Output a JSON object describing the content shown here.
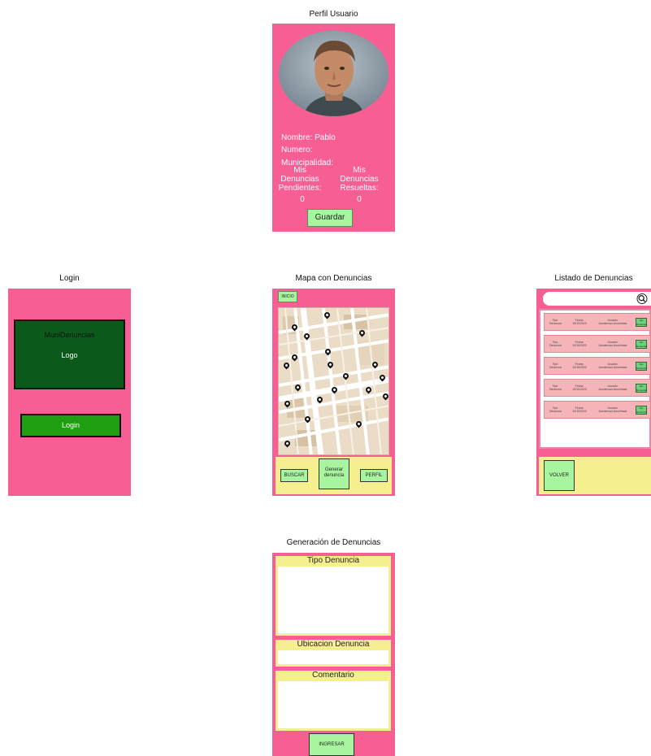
{
  "perfil": {
    "title": "Perfil Usuario",
    "nombre": "Nombre: Pablo",
    "numero": "Numero:",
    "municipalidad": "Municipalidad:",
    "pendientes_label": "Mis\nDenuncias\nPendientes:",
    "pendientes_value": "0",
    "resueltas_label": "Mis\nDenuncias\nResueltas:",
    "resueltas_value": "0",
    "guardar": "Guardar"
  },
  "login": {
    "title": "Login",
    "app_name": "MuniDenuncias",
    "logo": "Logo",
    "login_button": "Login"
  },
  "mapa": {
    "title": "Mapa con Denuncias",
    "inicio": "INICIO",
    "buscar": "BUSCAR",
    "generar": "Generar\ndenuncia",
    "perfil": "PERFIL"
  },
  "listado": {
    "title": "Listado de Denuncias",
    "rows": [
      {
        "tipo": "Tipo\nDenuncia",
        "fecha": "Fecha:\n10/10/2022",
        "usuario": "Usuario:\nAnonimous Anonimato",
        "action": "Ver\nDenuncia"
      },
      {
        "tipo": "Tipo\nDenuncia",
        "fecha": "Fecha:\n10/10/2022",
        "usuario": "Usuario:\nAnonimous Anonimato",
        "action": "Ver\nDenuncia"
      },
      {
        "tipo": "Tipo\nDenuncia",
        "fecha": "Fecha:\n10/10/2022",
        "usuario": "Usuario:\nAnonimous Anonimato",
        "action": "Ver\nDenuncia"
      },
      {
        "tipo": "Tipo\nDenuncia",
        "fecha": "Fecha:\n10/10/2022",
        "usuario": "Usuario:\nAnonimous Anonimato",
        "action": "Ver\nDenuncia"
      },
      {
        "tipo": "Tipo\nDenuncia",
        "fecha": "Fecha:\n10/10/2022",
        "usuario": "Usuario:\nAnonimous Anonimato",
        "action": "Ver\nDenuncia"
      }
    ],
    "volver": "VOLVER"
  },
  "generacion": {
    "title": "Generación de Denuncias",
    "tipo": "Tipo Denuncia",
    "ubicacion": "Ubicacion Denuncia",
    "comentario": "Comentario",
    "ingresar": "INGRESAR"
  },
  "colors": {
    "pink": "#f75e93",
    "dark_green": "#0b5a1c",
    "green": "#1f9e10",
    "light_green": "#a8f5a0",
    "yellow": "#f6ef8f"
  },
  "icons": {
    "search": "search-icon",
    "pin": "map-pin-icon",
    "avatar": "user-avatar"
  }
}
